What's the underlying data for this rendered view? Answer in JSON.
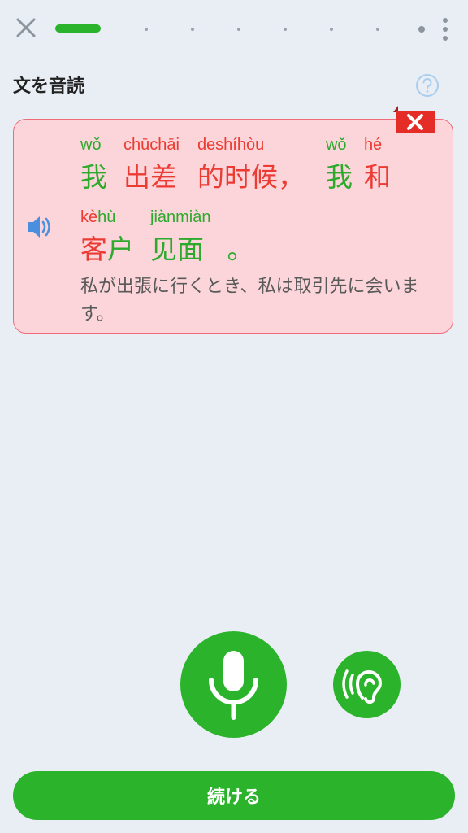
{
  "header": {
    "close_icon": "close-icon",
    "progress": {
      "current": 1,
      "total": 9
    },
    "more_icon": "vertical-ellipsis-icon"
  },
  "exercise": {
    "title": "文を音読",
    "help_icon": "question-circle-icon"
  },
  "result": {
    "status": "incorrect",
    "badge_icon": "red-x-icon",
    "speaker_icon": "speaker-icon",
    "lines": [
      [
        {
          "pinyin": "wǒ",
          "hanzi": "我",
          "pinyin_color": "green",
          "hanzi_color": "green"
        },
        {
          "pinyin": "chūchāi",
          "hanzi": "出差",
          "pinyin_color": "red",
          "hanzi_color": "red"
        },
        {
          "pinyin": "deshíhòu",
          "hanzi": "的时候",
          "pinyin_color": "red",
          "hanzi_color": "red"
        },
        {
          "pinyin": "",
          "hanzi": "，",
          "pinyin_color": "red",
          "hanzi_color": "red"
        },
        {
          "pinyin": "wǒ",
          "hanzi": "我",
          "pinyin_color": "green",
          "hanzi_color": "green"
        },
        {
          "pinyin": "hé",
          "hanzi": "和",
          "pinyin_color": "red",
          "hanzi_color": "red"
        }
      ],
      [
        {
          "pinyin": "kèhù",
          "hanzi": "客户",
          "split": true
        },
        {
          "pinyin": "jiànmiàn",
          "hanzi": "见面",
          "pinyin_color": "green",
          "hanzi_color": "green"
        },
        {
          "pinyin": "",
          "hanzi": "。",
          "pinyin_color": "green",
          "hanzi_color": "green"
        }
      ]
    ],
    "translation": "私が出張に行くとき、私は取引先に会います。"
  },
  "controls": {
    "mic_icon": "microphone-icon",
    "listen_icon": "ear-icon"
  },
  "footer": {
    "continue_label": "続ける"
  },
  "colors": {
    "accent_green": "#2bb32b",
    "correct_text": "#2daa2d",
    "wrong_text": "#ec3b33",
    "card_bg": "#fbd5d9",
    "card_border": "#ef6b78"
  }
}
